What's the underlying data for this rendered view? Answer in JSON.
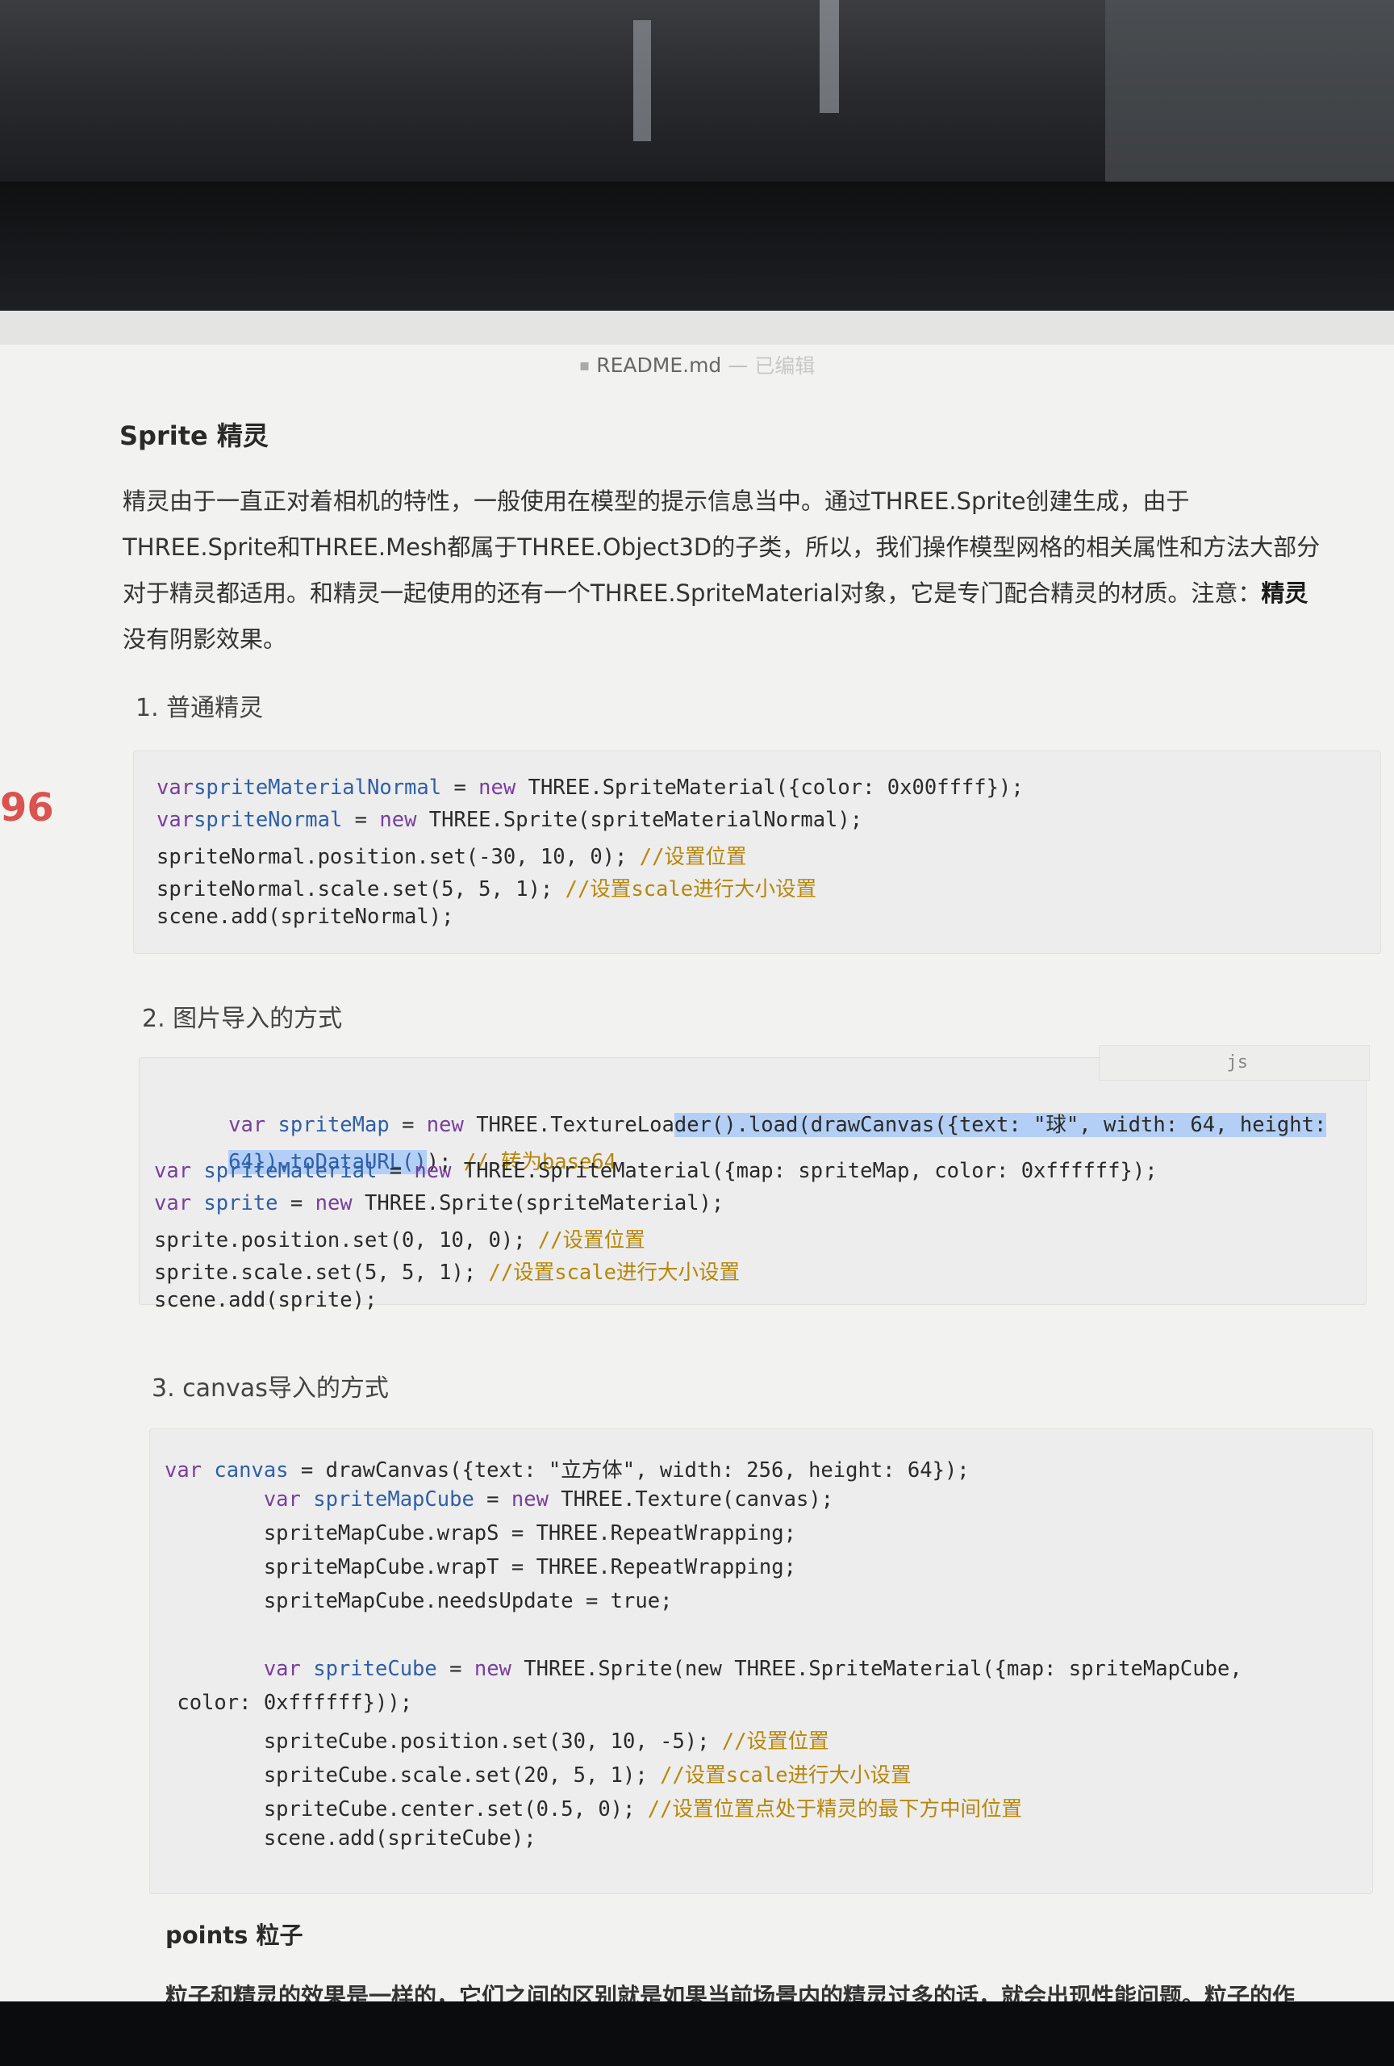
{
  "window": {
    "title_icon": "document-icon",
    "title": "README.md",
    "separator": "—",
    "status": "已编辑"
  },
  "gutter": {
    "line_number": "96"
  },
  "doc": {
    "sprite_heading": "Sprite 精灵",
    "sprite_para_lines": [
      "精灵由于一直正对着相机的特性，一般使用在模型的提示信息当中。通过THREE.Sprite创建生成，由于",
      "THREE.Sprite和THREE.Mesh都属于THREE.Object3D的子类，所以，我们操作模型网格的相关属性和方法大部分",
      "对于精灵都适用。和精灵一起使用的还有一个THREE.SpriteMaterial对象，它是专门配合精灵的材质。注意：",
      "没有阴影效果。"
    ],
    "sprite_para_bold_1": "精灵",
    "list": [
      "1.  普通精灵",
      "2.  图片导入的方式",
      "3.  canvas导入的方式"
    ],
    "code1": [
      {
        "k": "var",
        "v": "spriteMaterialNormal",
        "r": " = ",
        "n": "new",
        "t": " THREE.SpriteMaterial({color: 0x00ffff});",
        "c": ""
      },
      {
        "k": "var",
        "v": "spriteNormal",
        "r": " = ",
        "n": "new",
        "t": " THREE.Sprite(spriteMaterialNormal);",
        "c": ""
      },
      {
        "k": "",
        "v": "",
        "r": "",
        "n": "",
        "t": "spriteNormal.position.set(-30, 10, 0); ",
        "c": "//设置位置"
      },
      {
        "k": "",
        "v": "",
        "r": "",
        "n": "",
        "t": "spriteNormal.scale.set(5, 5, 1); ",
        "c": "//设置scale进行大小设置"
      },
      {
        "k": "",
        "v": "",
        "r": "",
        "n": "",
        "t": "scene.add(spriteNormal);",
        "c": ""
      }
    ],
    "code2": {
      "l1_a": "var",
      "l1_b": " spriteMap",
      "l1_c": " = ",
      "l1_d": "new",
      "l1_e": " THREE.TextureLoa",
      "l1_sel": "der().load(drawCanvas({text: \"球\", width: 64, height:",
      "l2_sel": "64}).toDataURL()",
      "l2_rest": "); ",
      "l2_cm": "// 转为base64",
      "lines": [
        {
          "k": "var",
          "v": " spriteMaterial",
          "r": " = ",
          "n": "new",
          "t": " THREE.SpriteMaterial({map: spriteMap, color: 0xffffff});",
          "c": ""
        },
        {
          "k": "var",
          "v": " sprite",
          "r": " = ",
          "n": "new",
          "t": " THREE.Sprite(spriteMaterial);",
          "c": ""
        },
        {
          "k": "",
          "v": "",
          "r": "",
          "n": "",
          "t": "sprite.position.set(0, 10, 0); ",
          "c": "//设置位置"
        },
        {
          "k": "",
          "v": "",
          "r": "",
          "n": "",
          "t": "sprite.scale.set(5, 5, 1); ",
          "c": "//设置scale进行大小设置"
        },
        {
          "k": "",
          "v": "",
          "r": "",
          "n": "",
          "t": "scene.add(sprite);",
          "c": ""
        }
      ],
      "lang": "js"
    },
    "code3": [
      {
        "k": "var",
        "v": " canvas",
        "r": " = ",
        "n": "",
        "t": "drawCanvas({text: \"立方体\", width: 256, height: 64});",
        "c": ""
      },
      {
        "k": "        var",
        "v": " spriteMapCube",
        "r": " = ",
        "n": "new",
        "t": " THREE.Texture(canvas);",
        "c": ""
      },
      {
        "k": "",
        "v": "",
        "r": "",
        "n": "",
        "t": "        spriteMapCube.wrapS = THREE.RepeatWrapping;",
        "c": ""
      },
      {
        "k": "",
        "v": "",
        "r": "",
        "n": "",
        "t": "        spriteMapCube.wrapT = THREE.RepeatWrapping;",
        "c": ""
      },
      {
        "k": "",
        "v": "",
        "r": "",
        "n": "",
        "t": "        spriteMapCube.needsUpdate = true;",
        "c": ""
      },
      {
        "k": "",
        "v": "",
        "r": "",
        "n": "",
        "t": "",
        "c": ""
      },
      {
        "k": "        var",
        "v": " spriteCube",
        "r": " = ",
        "n": "new",
        "t": " THREE.Sprite(new THREE.SpriteMaterial({map: spriteMapCube,",
        "c": ""
      },
      {
        "k": "",
        "v": "",
        "r": "",
        "n": "",
        "t": " color: 0xffffff}));",
        "c": ""
      },
      {
        "k": "",
        "v": "",
        "r": "",
        "n": "",
        "t": "        spriteCube.position.set(30, 10, -5); ",
        "c": "//设置位置"
      },
      {
        "k": "",
        "v": "",
        "r": "",
        "n": "",
        "t": "        spriteCube.scale.set(20, 5, 1); ",
        "c": "//设置scale进行大小设置"
      },
      {
        "k": "",
        "v": "",
        "r": "",
        "n": "",
        "t": "        spriteCube.center.set(0.5, 0); ",
        "c": "//设置位置点处于精灵的最下方中间位置"
      },
      {
        "k": "",
        "v": "",
        "r": "",
        "n": "",
        "t": "        scene.add(spriteCube);",
        "c": ""
      }
    ],
    "points_heading": "points 粒子",
    "points_para": "粒子和精灵的效果是一样的，它们之间的区别就是如果当前场景内的精灵过多的话，就会出现性能问题。粒子的作"
  }
}
